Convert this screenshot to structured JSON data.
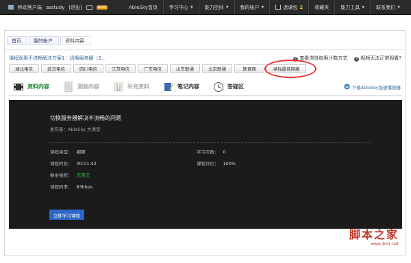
{
  "topbar": {
    "mobile_client": "移动客户端",
    "username": "asstudy",
    "logout": "[退出]",
    "new_badge": "NEW",
    "home": "AbleSky首页",
    "study_center": "学习中心",
    "ability_space": "能力空间",
    "my_account": "我的帐户",
    "cart_label": "选课包",
    "cart_count": "2",
    "favorites": "收藏夹",
    "ability_tools": "能力工具",
    "contact": "联系我们"
  },
  "breadcrumb": [
    "首页",
    "我的帐户",
    "资料内容"
  ],
  "notice": "课程观看不流畅解决方案1：切换服务器（2...",
  "help_links": [
    "查看浏览权限计数方式",
    "视频无法正常观看?"
  ],
  "servers": [
    "湖北电信",
    "武汉电信",
    "四川电信",
    "江苏电信",
    "广东电信",
    "山东联通",
    "北京联通",
    "教育网",
    "寻找最佳网络"
  ],
  "tabs": [
    "资料内容",
    "测验内容",
    "补充资料",
    "笔记内容",
    "答疑区"
  ],
  "download_label": "下载AbleSky加速播放器",
  "course": {
    "title": "切换服务器解决不流畅的问题",
    "author": "发布者：AbleSky 大课堂",
    "type_label": "课程类型：",
    "type_value": "视频",
    "duration_label": "课程时长：",
    "duration_value": "00:01:42",
    "remaining_label": "剩余授权：",
    "remaining_value": "无限次",
    "bitrate_label": "课程码率：",
    "bitrate_value": "83kbps",
    "count_label": "学习次数：",
    "count_value": "0",
    "rating_label": "课程评价：",
    "rating_value": "100%",
    "start_button": "立即学习课程"
  },
  "watermark": {
    "big": "脚本之家",
    "small": "www.jb51.net"
  },
  "colors": {
    "accent_green": "#1e8a2e",
    "button_blue": "#2c66c7",
    "ring_red": "#ee3333"
  }
}
